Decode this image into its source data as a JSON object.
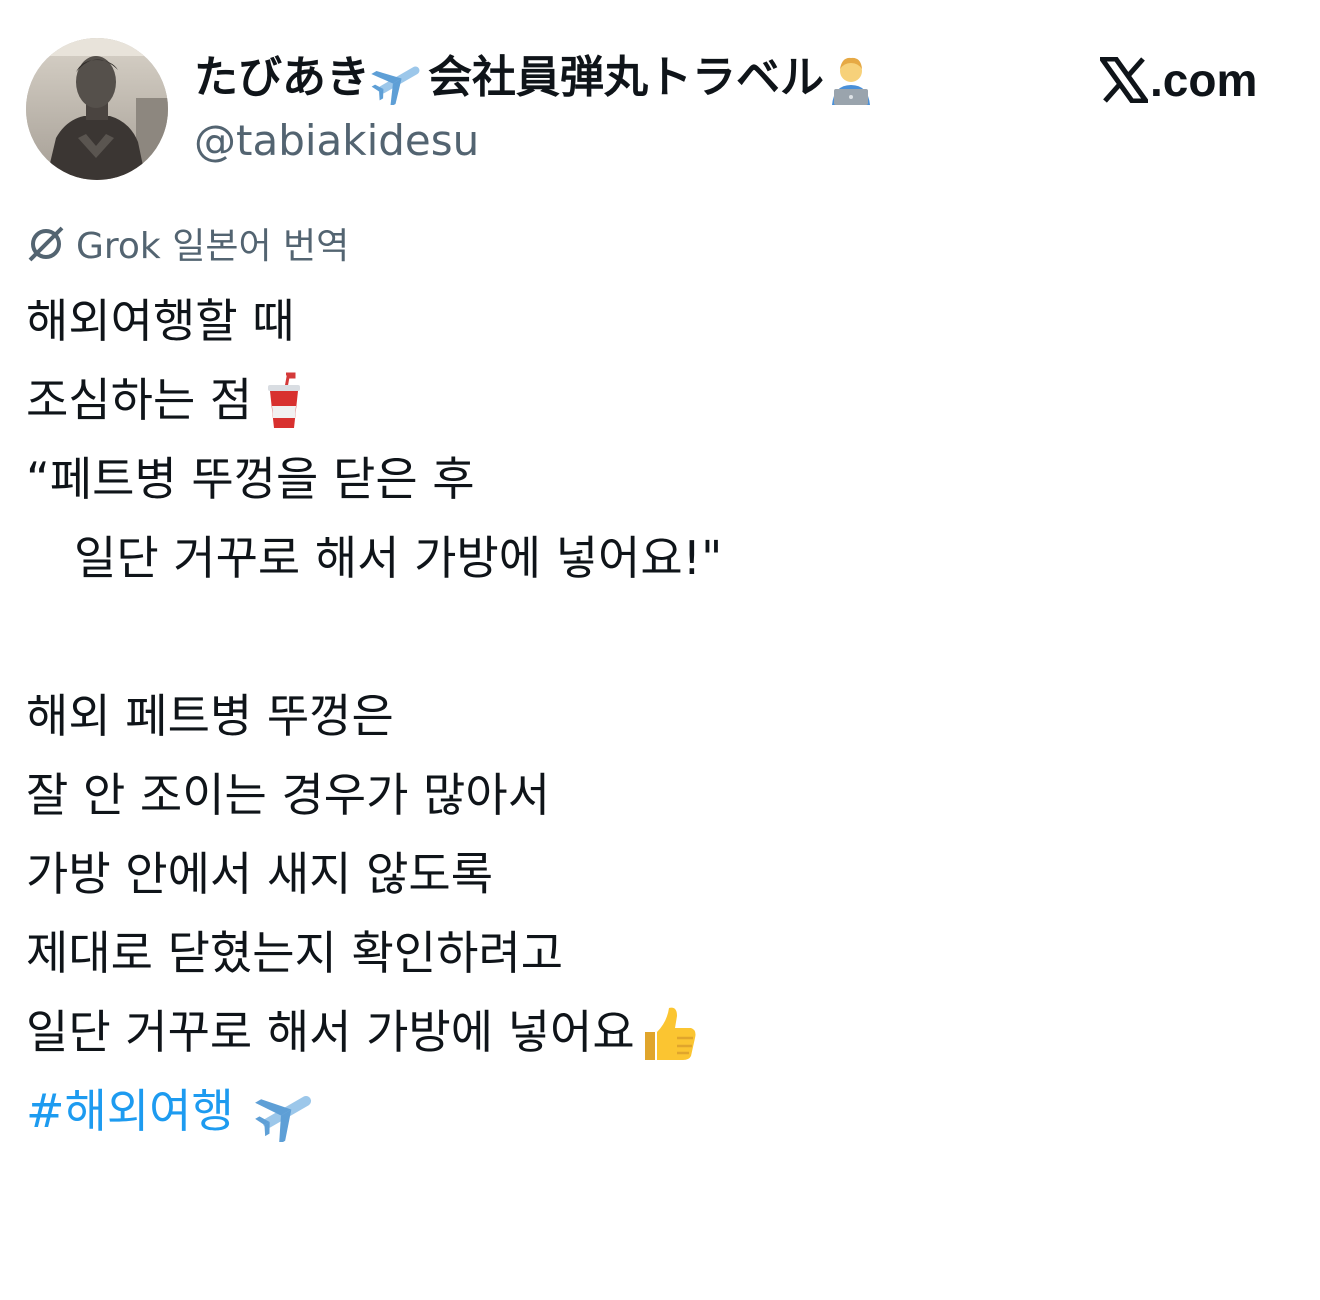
{
  "user": {
    "display_name": "たびあき",
    "display_name_suffix": "会社員弾丸トラベル",
    "handle": "@tabiakidesu"
  },
  "site": {
    "label": ".com",
    "logo_icon": "x-logo-icon"
  },
  "translation": {
    "label": "Grok 일본어 번역",
    "icon": "grok-icon"
  },
  "post": {
    "lines": [
      "해외여행할 때",
      "조심하는 점",
      "“페트병 뚜껑을 닫은 후",
      "일단 거꾸로 해서 가방에 넣어요!\"",
      "",
      "해외 페트병 뚜껑은",
      "잘 안 조이는 경우가 많아서",
      "가방 안에서 새지 않도록",
      "제대로 닫혔는지 확인하려고",
      "일단 거꾸로 해서 가방에 넣어요"
    ],
    "hashtag": "#해외여행"
  },
  "colors": {
    "text": "#0f1419",
    "secondary": "#536471",
    "link": "#1d9bf0"
  }
}
